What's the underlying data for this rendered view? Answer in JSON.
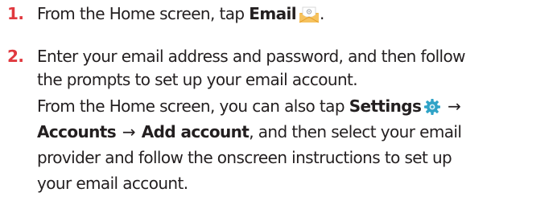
{
  "steps": [
    {
      "number": "1.",
      "lines": [
        {
          "text_before": "From the Home screen, tap ",
          "bold": "Email",
          "icon": "email-envelope-icon"
        }
      ]
    },
    {
      "number": "2.",
      "lines": [
        "Enter your email address and password, and then follow",
        "the prompts to set up your email account."
      ],
      "note": {
        "line1_text": "From the Home screen, you can also tap ",
        "line1_bold": "Settings",
        "line1_icon": "settings-gear-icon",
        "arrow": "→",
        "line2_bold_1": "Accounts",
        "line2_bold_2": "Add account",
        "line2_rest": ", and then select your email",
        "line3": "provider and follow the onscreen instructions to set up",
        "line4": "your email account."
      }
    }
  ],
  "colors": {
    "number": "#e0383e",
    "text": "#231f20",
    "gear": "#2fa3c7",
    "envelope": "#f3b441"
  }
}
